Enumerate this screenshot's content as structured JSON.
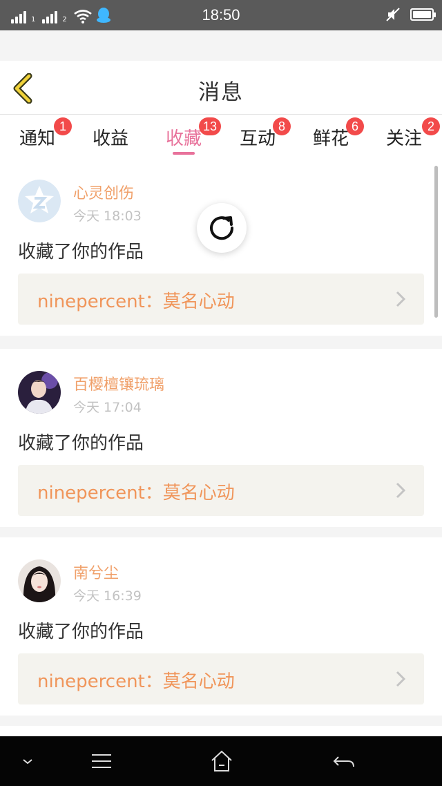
{
  "status_bar": {
    "time": "18:50",
    "sim1": "1",
    "sim2": "2",
    "icons": [
      "signal-icon",
      "wifi-icon",
      "qq-icon",
      "mute-icon",
      "battery-icon"
    ]
  },
  "header": {
    "title": "消息",
    "back_icon": "chevron-left-icon"
  },
  "tabs": [
    {
      "label": "通知",
      "badge": "1",
      "active": false
    },
    {
      "label": "收益",
      "badge": "",
      "active": false
    },
    {
      "label": "收藏",
      "badge": "13",
      "active": true
    },
    {
      "label": "互动",
      "badge": "8",
      "active": false
    },
    {
      "label": "鲜花",
      "badge": "6",
      "active": false
    },
    {
      "label": "关注",
      "badge": "2",
      "active": false
    }
  ],
  "colors": {
    "accent": "#e8729b",
    "badge": "#f24a4a",
    "name": "#f0a06a",
    "link": "#f0955a",
    "link_bg": "#f4f3ee"
  },
  "items": [
    {
      "user": "心灵创伤",
      "time": "今天 18:03",
      "action": "收藏了你的作品",
      "work": "ninepercent：莫名心动"
    },
    {
      "user": "百樱檀镶琉璃",
      "time": "今天 17:04",
      "action": "收藏了你的作品",
      "work": "ninepercent：莫名心动"
    },
    {
      "user": "南兮尘",
      "time": "今天 16:39",
      "action": "收藏了你的作品",
      "work": "ninepercent：莫名心动"
    }
  ],
  "nav": [
    "chevron-down-icon",
    "menu-icon",
    "home-icon",
    "back-icon"
  ]
}
